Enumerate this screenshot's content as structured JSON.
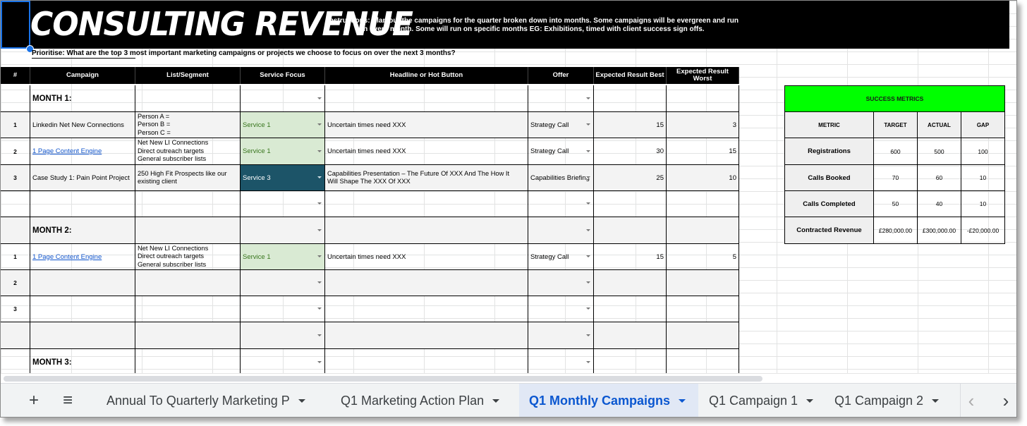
{
  "banner": {
    "title": "CONSULTING REVENUE",
    "instructions": "Instructions: Plan out the campaigns for the quarter broken down into months. Some campaigns will be evergreen and run in every month. Some will run on specific months EG: Exhibitions, timed with client success sign offs."
  },
  "prioritise": "Prioritise: What are the top 3 most important marketing campaigns or projects we choose to focus on over the next 3 months?",
  "headers": {
    "num": "#",
    "campaign": "Campaign",
    "segment": "List/Segment",
    "service": "Service Focus",
    "headline": "Headline or Hot Button",
    "offer": "Offer",
    "best": "Expected Result Best",
    "worst": "Expected Result Worst"
  },
  "months": {
    "m1": "MONTH 1:",
    "m2": "MONTH 2:",
    "m3": "MONTH 3:"
  },
  "rows": [
    {
      "num": "1",
      "campaign": "Linkedin Net New Connections",
      "segment": [
        "Person A =",
        "Person B =",
        "Person C ="
      ],
      "service": "Service 1",
      "headline": "Uncertain times need XXX",
      "offer": "Strategy Call",
      "best": "15",
      "worst": "3"
    },
    {
      "num": "2",
      "campaign": "1 Page Content Engine",
      "segment": [
        "Net New LI Connections",
        "Direct outreach targets",
        "General subscriber lists"
      ],
      "service": "Service 1",
      "headline": "Uncertain times need XXX",
      "offer": "Strategy Call",
      "best": "30",
      "worst": "15"
    },
    {
      "num": "3",
      "campaign": "Case Study 1: Pain Point Project",
      "segment": [
        "250 High Fit Prospects like our",
        "existing client"
      ],
      "service": "Service 3",
      "headline": [
        "Capabilities Presentation – The Future Of XXX And The How It",
        "Will Shape The XXX Of XXX"
      ],
      "offer": "Capabilities Briefing",
      "best": "25",
      "worst": "10"
    },
    {
      "num": "1",
      "campaign": "1 Page Content Engine",
      "segment": [
        "Net New LI Connections",
        "Direct outreach targets",
        "General subscriber lists"
      ],
      "service": "Service 1",
      "headline": "Uncertain times need XXX",
      "offer": "Strategy Call",
      "best": "15",
      "worst": "5"
    },
    {
      "num": "2"
    },
    {
      "num": "3"
    }
  ],
  "metrics": {
    "title": "SUCCESS METRICS",
    "headers": {
      "metric": "METRIC",
      "target": "TARGET",
      "actual": "ACTUAL",
      "gap": "GAP"
    },
    "rows": [
      {
        "name": "Registrations",
        "target": "600",
        "actual": "500",
        "gap": "100"
      },
      {
        "name": "Calls Booked",
        "target": "70",
        "actual": "60",
        "gap": "10"
      },
      {
        "name": "Calls Completed",
        "target": "50",
        "actual": "40",
        "gap": "10"
      },
      {
        "name": "Contracted Revenue",
        "target": "£280,000.00",
        "actual": "£300,000.00",
        "gap": "-£20,000.00"
      }
    ]
  },
  "tabs": {
    "add": "+",
    "menu": "≡",
    "items": [
      "Annual To Quarterly Marketing P",
      "Q1 Marketing Action Plan",
      "Q1 Monthly Campaigns",
      "Q1 Campaign 1",
      "Q1 Campaign 2"
    ],
    "prev": "‹",
    "next": "›"
  },
  "colors": {
    "success_green": "#00ff00",
    "service1_bg": "#d9ead3",
    "service3_bg": "#1c5468",
    "active_tab": "#0b57d0"
  }
}
